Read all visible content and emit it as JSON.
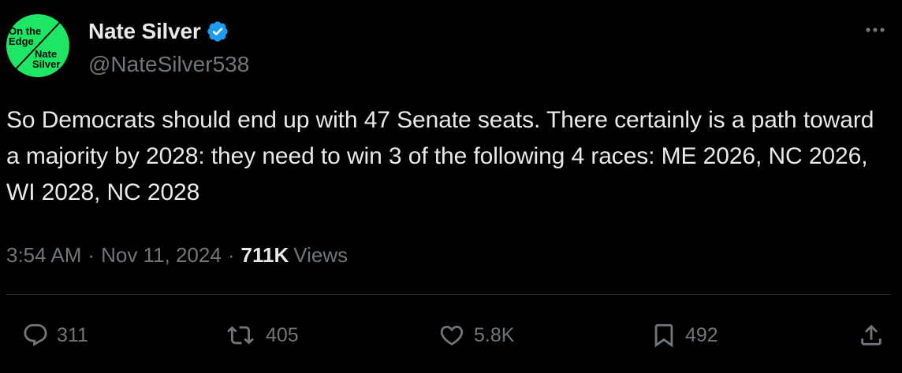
{
  "author": {
    "display_name": "Nate Silver",
    "handle": "@NateSilver538",
    "verified": true,
    "avatar": {
      "background_color": "#1ee564",
      "text_lines": [
        "On the",
        "Edge",
        "Nate",
        "Silver"
      ]
    }
  },
  "tweet": {
    "text": "So Democrats should end up with 47 Senate seats. There certainly is a path toward a majority by 2028: they need to win 3 of the following 4 races: ME 2026, NC 2026, WI 2028, NC 2028"
  },
  "meta": {
    "time": "3:54 AM",
    "separator": "·",
    "date": "Nov 11, 2024",
    "views_count": "711K",
    "views_label": "Views"
  },
  "actions": {
    "replies": "311",
    "reposts": "405",
    "likes": "5.8K",
    "bookmarks": "492"
  },
  "colors": {
    "background": "#000000",
    "text_primary": "#e7e9ea",
    "text_secondary": "#71767b",
    "divider": "#2f3336",
    "verified_blue": "#1d9bf0"
  },
  "icons": [
    "more-icon",
    "verified-badge-icon",
    "reply-icon",
    "repost-icon",
    "like-icon",
    "bookmark-icon",
    "share-icon"
  ]
}
